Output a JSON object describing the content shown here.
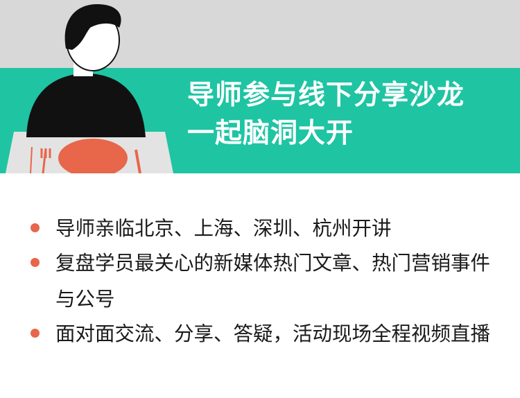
{
  "banner": {
    "headline_line1": "导师参与线下分享沙龙",
    "headline_line2": "一起脑洞大开"
  },
  "bullets": [
    "导师亲临北京、上海、深圳、杭州开讲",
    "复盘学员最关心的新媒体热门文章、热门营销事件与公号",
    "面对面交流、分享、答疑，活动现场全程视频直播"
  ],
  "colors": {
    "accent_green": "#1fc4a3",
    "banner_gray": "#d8d8d8",
    "bullet_orange": "#e8664a",
    "plate_orange": "#e8664a"
  },
  "icons": {
    "illustration": "person-at-dining-table-illustration",
    "bullet": "orange-dot"
  }
}
